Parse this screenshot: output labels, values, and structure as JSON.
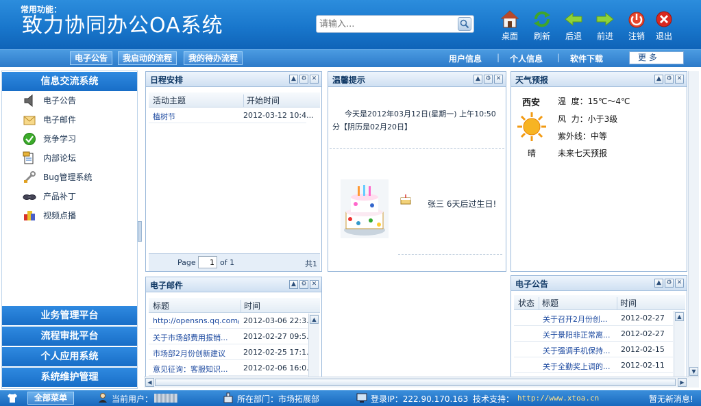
{
  "header": {
    "title": "致力协同办公OA系统",
    "search_placeholder": "请输入...",
    "toolbar": [
      {
        "label": "桌面",
        "icon": "home-icon"
      },
      {
        "label": "刷新",
        "icon": "refresh-icon"
      },
      {
        "label": "后退",
        "icon": "back-arrow-icon"
      },
      {
        "label": "前进",
        "icon": "forward-arrow-icon"
      },
      {
        "label": "注销",
        "icon": "power-icon"
      },
      {
        "label": "退出",
        "icon": "close-icon"
      }
    ]
  },
  "navbar": {
    "quick_label": "常用功能：",
    "quick_buttons": [
      "电子公告",
      "我启动的流程",
      "我的待办流程"
    ],
    "links": [
      "用户信息",
      "个人信息",
      "软件下载"
    ],
    "more": "更 多"
  },
  "sidebar": {
    "active_group": "信息交流系统",
    "items": [
      {
        "label": "电子公告",
        "icon": "speaker-icon"
      },
      {
        "label": "电子邮件",
        "icon": "envelope-icon"
      },
      {
        "label": "竞争学习",
        "icon": "check-circle-icon"
      },
      {
        "label": "内部论坛",
        "icon": "forum-icon"
      },
      {
        "label": "Bug管理系统",
        "icon": "wrench-icon"
      },
      {
        "label": "产品补丁",
        "icon": "patch-icon"
      },
      {
        "label": "视频点播",
        "icon": "video-icon"
      }
    ],
    "groups": [
      "业务管理平台",
      "流程审批平台",
      "个人应用系统",
      "系统维护管理"
    ]
  },
  "schedule": {
    "title": "日程安排",
    "columns": [
      "活动主题",
      "开始时间"
    ],
    "rows": [
      {
        "subject": "植树节",
        "start": "2012-03-12 10:4..."
      }
    ],
    "pager": {
      "page_label": "Page",
      "page": "1",
      "of": "of 1",
      "total": "共1"
    }
  },
  "tips": {
    "title": "温馨提示",
    "today": "今天是2012年03月12日(星期一) 上午10:50分【阴历是02月20日】",
    "birthday": "张三 6天后过生日!"
  },
  "weather": {
    "title": "天气预报",
    "city": "西安",
    "condition": "晴",
    "temperature": "温  度：15℃～4℃",
    "wind": "风  力：小于3级",
    "uv": "紫外线：中等",
    "forecast_link": "未来七天预报"
  },
  "email": {
    "title": "电子邮件",
    "columns": [
      "标题",
      "时间"
    ],
    "rows": [
      {
        "subject": "http://opensns.qq.com/...",
        "time": "2012-03-06 22:3..."
      },
      {
        "subject": "关于市场部费用报销...",
        "time": "2012-02-27 09:5..."
      },
      {
        "subject": "市场部2月份创新建议",
        "time": "2012-02-25 17:1..."
      },
      {
        "subject": "意见征询：客服知识...",
        "time": "2012-02-06 16:0..."
      }
    ]
  },
  "notice": {
    "title": "电子公告",
    "columns": [
      "状态",
      "标题",
      "时间"
    ],
    "rows": [
      {
        "subject": "关于召开2月份创...",
        "time": "2012-02-27"
      },
      {
        "subject": "关于景阳非正常离...",
        "time": "2012-02-27"
      },
      {
        "subject": "关于强调手机保持...",
        "time": "2012-02-15"
      },
      {
        "subject": "关于全勤奖上调的...",
        "time": "2012-02-11"
      }
    ]
  },
  "footer": {
    "all_menu": "全部菜单",
    "current_user_label": "当前用户：",
    "department": "所在部门：市场拓展部",
    "login_ip": "登录IP：222.90.170.163",
    "support_label": "技术支持：",
    "support_url": "http://www.xtoa.cn",
    "messages": "暂无新消息!"
  }
}
